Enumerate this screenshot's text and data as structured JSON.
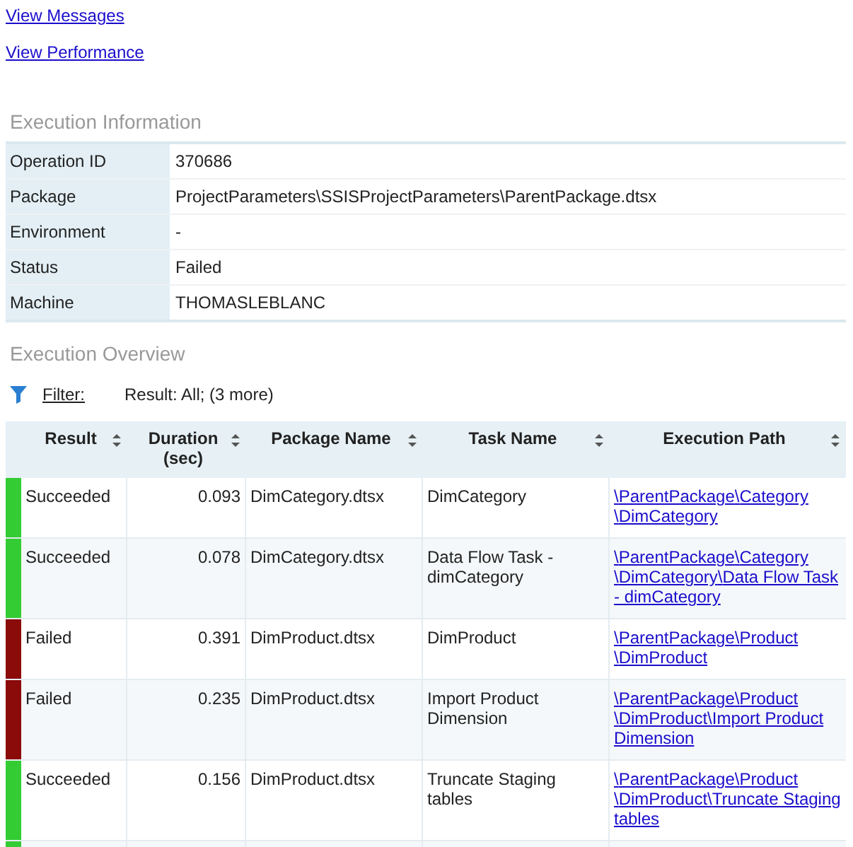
{
  "links": [
    "View Messages",
    "View Performance"
  ],
  "execution_information": {
    "title": "Execution Information",
    "rows": [
      {
        "label": "Operation ID",
        "value": "370686"
      },
      {
        "label": "Package",
        "value": "ProjectParameters\\SSISProjectParameters\\ParentPackage.dtsx"
      },
      {
        "label": "Environment",
        "value": "-"
      },
      {
        "label": "Status",
        "value": "Failed"
      },
      {
        "label": "Machine",
        "value": "THOMASLEBLANC"
      }
    ]
  },
  "execution_overview": {
    "title": "Execution Overview",
    "filter": {
      "label": "Filter:",
      "value": "Result: All;  (3 more)"
    },
    "columns": [
      {
        "label": "Result",
        "kind": "text"
      },
      {
        "label": "Duration (sec)",
        "kind": "number"
      },
      {
        "label": "Package Name",
        "kind": "text"
      },
      {
        "label": "Task Name",
        "kind": "text"
      },
      {
        "label": "Execution Path",
        "kind": "link"
      }
    ],
    "rows": [
      {
        "color": "#33cc33",
        "cells": [
          "Succeeded",
          "0.093",
          "DimCategory.dtsx",
          "DimCategory",
          "\\ParentPackage\\Category\\DimCategory"
        ]
      },
      {
        "color": "#33cc33",
        "cells": [
          "Succeeded",
          "0.078",
          "DimCategory.dtsx",
          "Data Flow Task - dimCategory",
          "\\ParentPackage\\Category\\DimCategory\\Data Flow Task - dimCategory"
        ]
      },
      {
        "color": "#8b0a0a",
        "cells": [
          "Failed",
          "0.391",
          "DimProduct.dtsx",
          "DimProduct",
          "\\ParentPackage\\Product\\DimProduct"
        ]
      },
      {
        "color": "#8b0a0a",
        "cells": [
          "Failed",
          "0.235",
          "DimProduct.dtsx",
          "Import Product Dimension",
          "\\ParentPackage\\Product\\DimProduct\\Import Product Dimension"
        ]
      },
      {
        "color": "#33cc33",
        "cells": [
          "Succeeded",
          "0.156",
          "DimProduct.dtsx",
          "Truncate Staging tables",
          "\\ParentPackage\\Product\\DimProduct\\Truncate Staging tables"
        ]
      },
      {
        "color": "#33cc33",
        "cells": []
      }
    ]
  }
}
